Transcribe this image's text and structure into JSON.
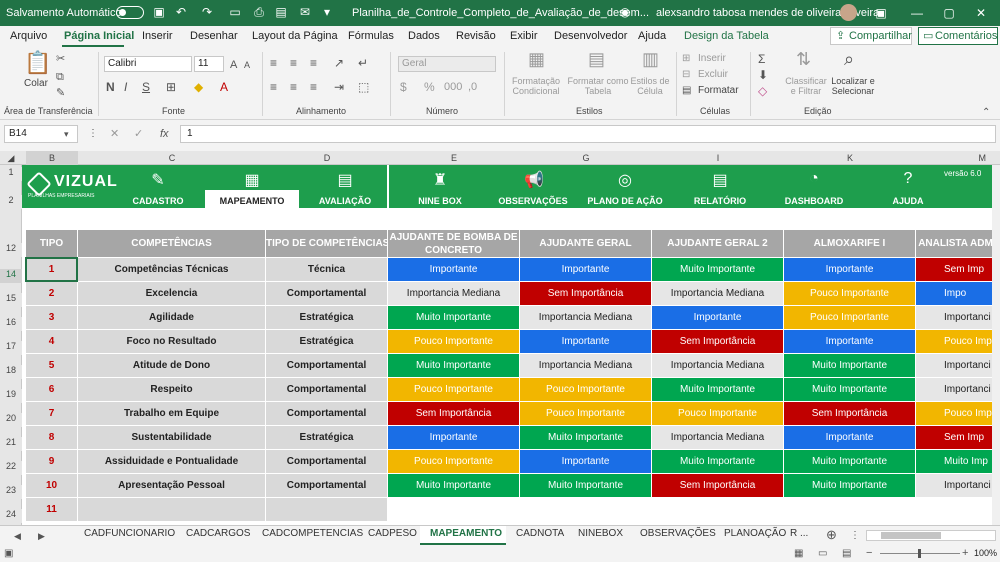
{
  "titlebar": {
    "autosave_label": "Salvamento Automático",
    "doc_title": "Planilha_de_Controle_Completo_de_Avaliação_de_desem...",
    "user_name": "alexsandro tabosa mendes de oliveira oliveira"
  },
  "menu": {
    "items": [
      "Arquivo",
      "Página Inicial",
      "Inserir",
      "Desenhar",
      "Layout da Página",
      "Fórmulas",
      "Dados",
      "Revisão",
      "Exibir",
      "Desenvolvedor",
      "Ajuda",
      "Design da Tabela"
    ],
    "active": "Página Inicial",
    "share_label": "Compartilhar",
    "comments_label": "Comentários"
  },
  "ribbon": {
    "paste_label": "Colar",
    "clipboard_group": "Área de Transferência",
    "font_name": "Calibri",
    "font_size": "11",
    "font_group": "Fonte",
    "bold": "N",
    "italic": "I",
    "underline": "S",
    "alignment_group": "Alinhamento",
    "number_format": "Geral",
    "number_group": "Número",
    "cond_format": "Formatação Condicional",
    "format_table": "Formatar como Tabela",
    "cell_styles": "Estilos de Célula",
    "styles_group": "Estilos",
    "insert": "Inserir",
    "delete": "Excluir",
    "format": "Formatar",
    "cells_group": "Células",
    "sort_filter": "Classificar e Filtrar",
    "find_select": "Localizar e Selecionar",
    "edit_group": "Edição"
  },
  "formula_bar": {
    "name_box": "B14",
    "formula": "1"
  },
  "columns": [
    "A",
    "B",
    "C",
    "D",
    "E",
    "G",
    "I",
    "K",
    "M"
  ],
  "rows": [
    "1",
    "2",
    "",
    "12",
    "14",
    "15",
    "16",
    "17",
    "18",
    "19",
    "20",
    "21",
    "22",
    "23",
    "24"
  ],
  "nav": {
    "logo": "VIZUAL",
    "logo_sub": "PLANILHAS EMPRESARIAIS",
    "version": "versão 6.0",
    "items": [
      "CADASTRO",
      "MAPEAMENTO",
      "AVALIAÇÃO",
      "NINE BOX",
      "OBSERVAÇÕES",
      "PLANO DE AÇÃO",
      "RELATÓRIO",
      "DASHBOARD",
      "AJUDA"
    ],
    "active": "MAPEAMENTO"
  },
  "table": {
    "headers": [
      "TIPO",
      "COMPETÊNCIAS",
      "TIPO DE COMPETÊNCIAS",
      "AJUDANTE DE BOMBA DE CONCRETO",
      "AJUDANTE GERAL",
      "AJUDANTE GERAL 2",
      "ALMOXARIFE I",
      "ANALISTA ADM"
    ],
    "rows": [
      {
        "tipo": "1",
        "comp": "Competências Técnicas",
        "tipo_comp": "Técnica",
        "vals": [
          "Importante",
          "Importante",
          "Muito Importante",
          "Importante",
          "Sem Imp"
        ]
      },
      {
        "tipo": "2",
        "comp": "Excelencia",
        "tipo_comp": "Comportamental",
        "vals": [
          "Importancia Mediana",
          "Sem Importância",
          "Importancia Mediana",
          "Pouco Importante",
          "Impo"
        ]
      },
      {
        "tipo": "3",
        "comp": "Agilidade",
        "tipo_comp": "Estratégica",
        "vals": [
          "Muito Importante",
          "Importancia Mediana",
          "Importante",
          "Pouco Importante",
          "Importanci"
        ]
      },
      {
        "tipo": "4",
        "comp": "Foco no Resultado",
        "tipo_comp": "Estratégica",
        "vals": [
          "Pouco Importante",
          "Importante",
          "Sem Importância",
          "Importante",
          "Pouco Imp"
        ]
      },
      {
        "tipo": "5",
        "comp": "Atitude de Dono",
        "tipo_comp": "Comportamental",
        "vals": [
          "Muito Importante",
          "Importancia Mediana",
          "Importancia Mediana",
          "Muito Importante",
          "Importanci"
        ]
      },
      {
        "tipo": "6",
        "comp": "Respeito",
        "tipo_comp": "Comportamental",
        "vals": [
          "Pouco Importante",
          "Pouco Importante",
          "Muito Importante",
          "Muito Importante",
          "Importanci"
        ]
      },
      {
        "tipo": "7",
        "comp": "Trabalho em Equipe",
        "tipo_comp": "Comportamental",
        "vals": [
          "Sem Importância",
          "Pouco Importante",
          "Pouco Importante",
          "Sem Importância",
          "Pouco Imp"
        ]
      },
      {
        "tipo": "8",
        "comp": "Sustentabilidade",
        "tipo_comp": "Estratégica",
        "vals": [
          "Importante",
          "Muito Importante",
          "Importancia Mediana",
          "Importante",
          "Sem Imp"
        ]
      },
      {
        "tipo": "9",
        "comp": "Assiduidade e Pontualidade",
        "tipo_comp": "Comportamental",
        "vals": [
          "Pouco Importante",
          "Importante",
          "Muito Importante",
          "Muito Importante",
          "Muito Imp"
        ]
      },
      {
        "tipo": "10",
        "comp": "Apresentação Pessoal",
        "tipo_comp": "Comportamental",
        "vals": [
          "Muito Importante",
          "Muito Importante",
          "Sem Importância",
          "Muito Importante",
          "Importanci"
        ]
      },
      {
        "tipo": "11",
        "comp": "",
        "tipo_comp": "",
        "vals": [
          "",
          "",
          "",
          "",
          ""
        ]
      }
    ],
    "colors": {
      "Importante": "#1a6ee6",
      "Muito Importante": "#00a650",
      "Sem Importância": "#c00000",
      "Pouco Importante": "#f2b600",
      "Importancia Mediana": "#e6e6e6"
    }
  },
  "sheet_tabs": [
    "CADFUNCIONARIO",
    "CADCARGOS",
    "CADCOMPETENCIAS",
    "CADPESO",
    "MAPEAMENTO",
    "CADNOTA",
    "NINEBOX",
    "OBSERVAÇÕES",
    "PLANOAÇÃO",
    "R ..."
  ],
  "active_sheet": "MAPEAMENTO",
  "status": {
    "zoom": "100%"
  }
}
